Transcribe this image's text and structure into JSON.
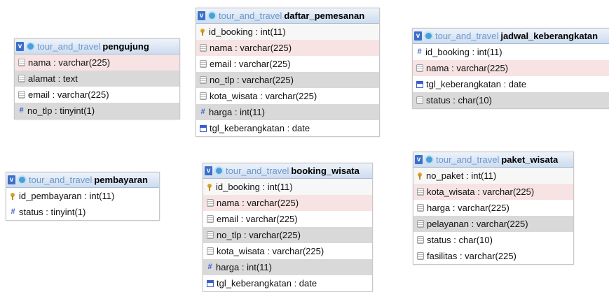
{
  "db_name": "tour_and_travel",
  "toggle": "v",
  "tables": [
    {
      "name": "pengujung",
      "columns": [
        {
          "icon": "text-column-icon",
          "text": "nama : varchar(225)"
        },
        {
          "icon": "text-column-icon",
          "text": "alamat : text"
        },
        {
          "icon": "text-column-icon",
          "text": "email : varchar(225)"
        },
        {
          "icon": "numeric-column-icon",
          "text": "no_tlp : tinyint(1)"
        }
      ]
    },
    {
      "name": "daftar_pemesanan",
      "columns": [
        {
          "icon": "primary-key-icon",
          "text": "id_booking : int(11)"
        },
        {
          "icon": "text-column-icon",
          "text": "nama : varchar(225)"
        },
        {
          "icon": "text-column-icon",
          "text": "email : varchar(225)"
        },
        {
          "icon": "text-column-icon",
          "text": "no_tlp : varchar(225)"
        },
        {
          "icon": "text-column-icon",
          "text": "kota_wisata : varchar(225)"
        },
        {
          "icon": "numeric-column-icon",
          "text": "harga : int(11)"
        },
        {
          "icon": "date-column-icon",
          "text": "tgl_keberangkatan : date"
        }
      ]
    },
    {
      "name": "jadwal_keberangkatan",
      "columns": [
        {
          "icon": "numeric-column-icon",
          "text": "id_booking : int(11)"
        },
        {
          "icon": "text-column-icon",
          "text": "nama : varchar(225)"
        },
        {
          "icon": "date-column-icon",
          "text": "tgl_keberangkatan : date"
        },
        {
          "icon": "text-column-icon",
          "text": "status : char(10)"
        }
      ]
    },
    {
      "name": "pembayaran",
      "columns": [
        {
          "icon": "primary-key-icon",
          "text": "id_pembayaran : int(11)"
        },
        {
          "icon": "numeric-column-icon",
          "text": "status : tinyint(1)"
        }
      ]
    },
    {
      "name": "booking_wisata",
      "columns": [
        {
          "icon": "primary-key-icon",
          "text": "id_booking : int(11)"
        },
        {
          "icon": "text-column-icon",
          "text": "nama : varchar(225)"
        },
        {
          "icon": "text-column-icon",
          "text": "email : varchar(225)"
        },
        {
          "icon": "text-column-icon",
          "text": "no_tlp : varchar(225)"
        },
        {
          "icon": "text-column-icon",
          "text": "kota_wisata : varchar(225)"
        },
        {
          "icon": "numeric-column-icon",
          "text": "harga : int(11)"
        },
        {
          "icon": "date-column-icon",
          "text": "tgl_keberangkatan : date"
        }
      ]
    },
    {
      "name": "paket_wisata",
      "columns": [
        {
          "icon": "primary-key-icon",
          "text": "no_paket : int(11)"
        },
        {
          "icon": "text-column-icon",
          "text": "kota_wisata : varchar(225)"
        },
        {
          "icon": "text-column-icon",
          "text": "harga : varchar(225)"
        },
        {
          "icon": "text-column-icon",
          "text": "pelayanan : varchar(225)"
        },
        {
          "icon": "text-column-icon",
          "text": "status : char(10)"
        },
        {
          "icon": "text-column-icon",
          "text": "fasilitas : varchar(225)"
        }
      ]
    }
  ]
}
